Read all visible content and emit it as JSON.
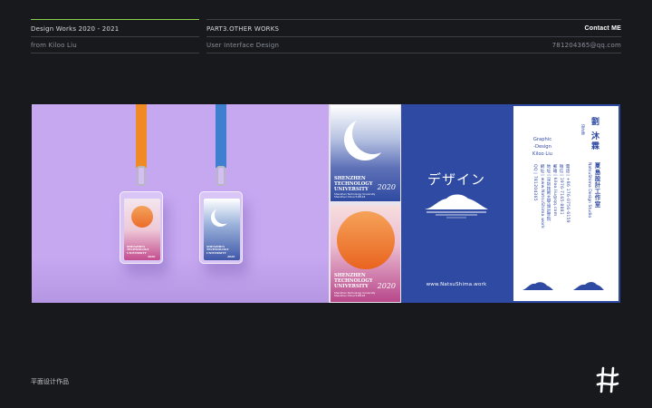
{
  "header": {
    "left_title": "Design  Works 2020 - 2021",
    "left_sub": "from  Kiloo Liu",
    "mid_title": "PART3.OTHER WORKS",
    "mid_sub": "User  Interface  Design",
    "right_title": "Contact ME",
    "right_sub": "781204365@qq.com"
  },
  "lanyard": {
    "card_title": "SHENZHEN TECHNOLOGY UNIVERSITY",
    "card_year": "2020"
  },
  "cards": {
    "top": {
      "title_lines": [
        "SHENZHEN",
        "TECHNOLOGY",
        "UNIVERSITY"
      ],
      "year": "2020",
      "fine_print": "Shenzhen Technology University Shenzhen China 518118"
    },
    "bottom": {
      "title_lines": [
        "SHENZHEN",
        "TECHNOLOGY",
        "UNIVERSITY"
      ],
      "year": "2020",
      "fine_print": "Shenzhen Technology University Shenzhen China 518118"
    }
  },
  "blue_panel": {
    "katakana": "デザイン",
    "website": "www.NatsuShima.work"
  },
  "business_card": {
    "name": "劉 沐霖",
    "name_sub": "設計師",
    "studio_cn": "夏島設計工作室",
    "studio_en": "NatsuShima Design Studio",
    "role": [
      "Graphic",
      "-Design",
      "Kiloo Liu"
    ],
    "info": [
      "電話 | +86 176-0756-6159",
      "微信 | 1976-7165-8881",
      "郵箱 | kiloo.liu@qq.com",
      "地址 | 深圳技術大學設計學院",
      "網址 | www.NatsuShima.work",
      "QQ | 781204365"
    ]
  },
  "footer": {
    "label": "平面设计作品"
  },
  "colors": {
    "background": "#17191d",
    "accent_green": "#8bd04a",
    "brand_blue": "#2f4aa3",
    "lavender": "#c6a8f1",
    "sun_orange": "#ec6b2a",
    "strap_orange": "#f08a24",
    "strap_blue": "#3f7fd0"
  },
  "icons": {
    "logo": "hash-logo-icon",
    "moon": "crescent-moon-icon",
    "sun": "sun-circle-icon",
    "island": "island-icon",
    "mountain": "mountain-icon"
  }
}
